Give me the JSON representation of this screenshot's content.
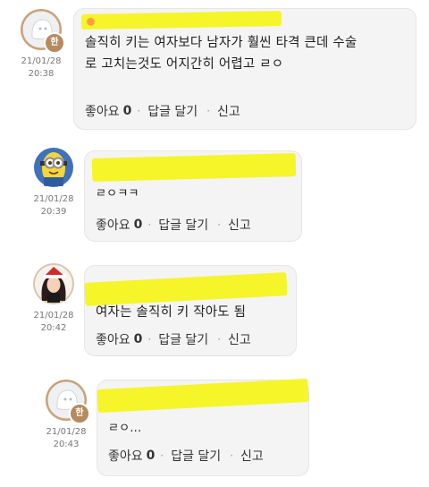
{
  "comments": [
    {
      "author_avatar": "ghost-avatar",
      "badge": "한",
      "date": "21/01/28",
      "time": "20:38",
      "text_lines": [
        "솔직히 키는 여자보다 남자가 훨씬 타격 큰데 수술",
        "로 고치는것도 어지간히 어렵고 ㄹㅇ"
      ],
      "like_label": "좋아요",
      "like_count": "0",
      "reply_label": "답글 달기",
      "report_label": "신고"
    },
    {
      "author_avatar": "minion-avatar",
      "badge": "",
      "date": "21/01/28",
      "time": "20:39",
      "text_lines": [
        "ㄹㅇㅋㅋ"
      ],
      "like_label": "좋아요",
      "like_count": "0",
      "reply_label": "답글 달기",
      "report_label": "신고"
    },
    {
      "author_avatar": "santa-girl-avatar",
      "badge": "",
      "date": "21/01/28",
      "time": "20:42",
      "text_lines": [
        "여자는 솔직히 키 작아도 됨"
      ],
      "like_label": "좋아요",
      "like_count": "0",
      "reply_label": "답글 달기",
      "report_label": "신고"
    },
    {
      "author_avatar": "ghost-avatar",
      "badge": "한",
      "date": "21/01/28",
      "time": "20:43",
      "text_lines": [
        "ㄹㅇ..."
      ],
      "like_label": "좋아요",
      "like_count": "0",
      "reply_label": "답글 달기",
      "report_label": "신고"
    }
  ],
  "colors": {
    "highlight": "#f5f52a",
    "bubble": "#f4f4f4",
    "badge": "#b58a5e"
  }
}
